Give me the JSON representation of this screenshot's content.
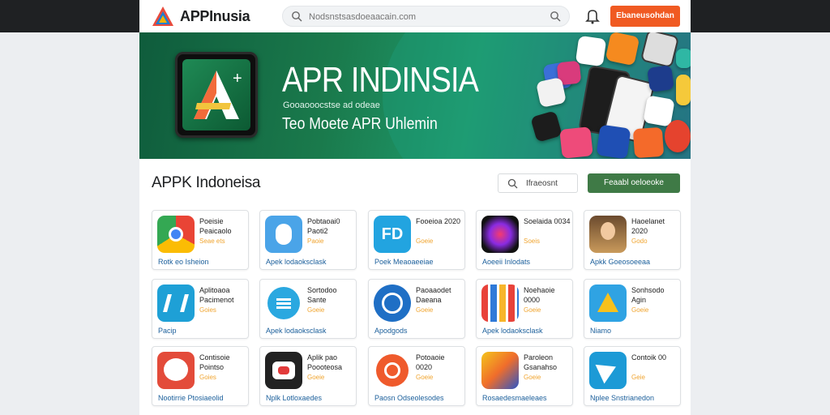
{
  "brand": {
    "name": "APPInusia"
  },
  "search": {
    "placeholder": "Nodsnstsasdoeaacain.com"
  },
  "header": {
    "download_label": "Ebaneusohdan"
  },
  "hero": {
    "title": "APR INDINSIA",
    "subtitle": "Gooaooocstse ad odeae",
    "tagline": "Teo Moete APR Uhlemin"
  },
  "section": {
    "title": "APPK Indoneisa",
    "filter_label": "Ifraeosnt",
    "action_label": "Feaabl oeloeoke"
  },
  "apps": [
    {
      "name": "Poeisie Peaicaolo",
      "meta": "Seae ets",
      "cta": "Rotk eo Isheion",
      "icon": "chrome-like-icon"
    },
    {
      "name": "Pobtaoai0 Paoti2",
      "meta": "Paoie",
      "cta": "Apek lodaoksclask",
      "icon": "mascot-icon"
    },
    {
      "name": "Fooeioa 2020",
      "meta": "Goeie",
      "cta": "Poek Meaoaeeiae",
      "icon": "fd-icon"
    },
    {
      "name": "Soelaida 0034",
      "meta": "Soeis",
      "cta": "Aoeeii Inlodats",
      "icon": "butterfly-icon"
    },
    {
      "name": "Haoelanet 2020",
      "meta": "Godo",
      "cta": "Apkk Goeosoeeaa",
      "icon": "portrait-icon"
    },
    {
      "name": "Aplitoaoa Pacimenot",
      "meta": "Goies",
      "cta": "Pacip",
      "icon": "bars-icon"
    },
    {
      "name": "Sortodoo Sante",
      "meta": "Goeie",
      "cta": "Apek lodaoksclask",
      "icon": "menu-icon"
    },
    {
      "name": "Paoaaodet Daeana",
      "meta": "Goeie",
      "cta": "Apodgods",
      "icon": "compass-icon"
    },
    {
      "name": "Noehaoie 0000",
      "meta": "Goeie",
      "cta": "Apek lodaoksclask",
      "icon": "grid-icon"
    },
    {
      "name": "Sonhsodo Agin",
      "meta": "Goeie",
      "cta": "Niamo",
      "icon": "triangle-icon"
    },
    {
      "name": "Contisoie Pointso",
      "meta": "Goies",
      "cta": "Nootirrie Ptosiaeolid",
      "icon": "chat-icon"
    },
    {
      "name": "Aplik pao Poooteosa",
      "meta": "Goeie",
      "cta": "Nplk Lotloxaedes",
      "icon": "record-icon"
    },
    {
      "name": "Potoaoie 0020",
      "meta": "Goeie",
      "cta": "Paosn Odseolesodes",
      "icon": "clock-icon"
    },
    {
      "name": "Paroleon Gsanahso",
      "meta": "Goeie",
      "cta": "Rosaedesmaeleaes",
      "icon": "game-icon"
    },
    {
      "name": "Contoik 00",
      "meta": "Geie",
      "cta": "Nplee Snstrianedon",
      "icon": "arrow-icon"
    }
  ]
}
